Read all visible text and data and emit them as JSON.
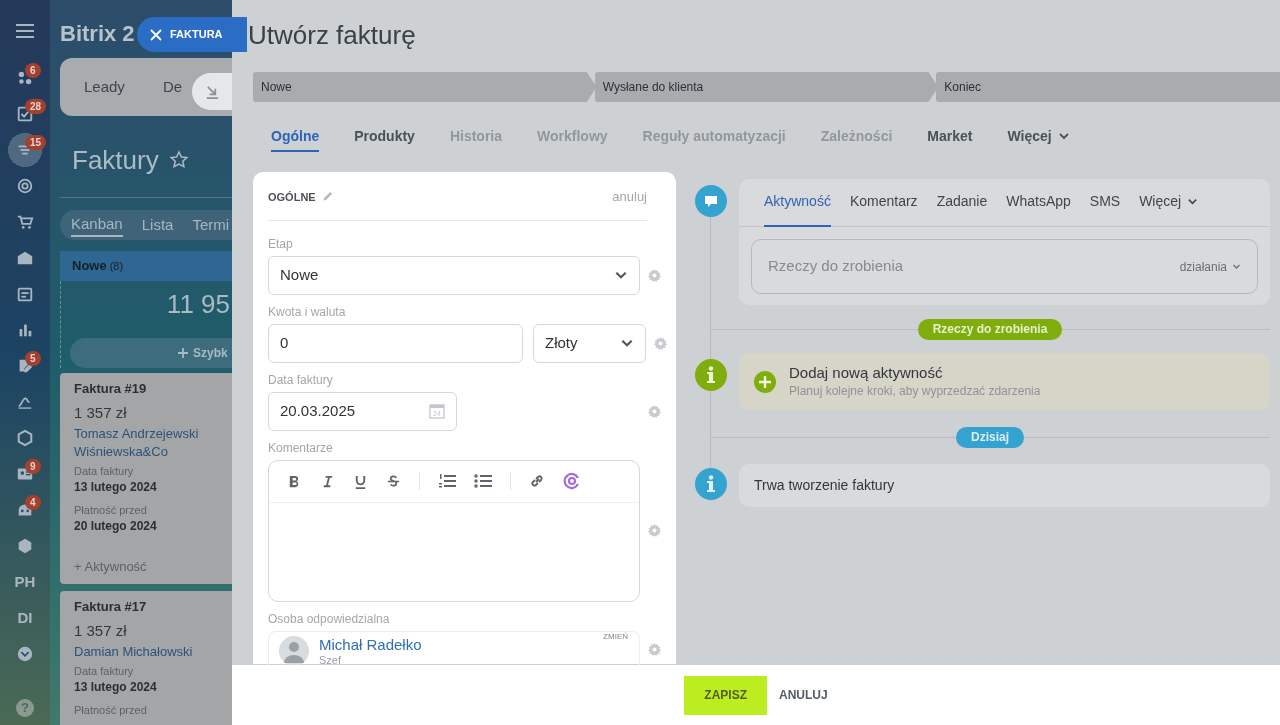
{
  "nav": {
    "items": [
      {
        "kind": "icon",
        "badge": "6",
        "selected": false
      },
      {
        "kind": "icon",
        "badge": "28",
        "selected": false
      },
      {
        "kind": "icon",
        "badge": "15",
        "selected": true
      },
      {
        "kind": "icon",
        "selected": false
      },
      {
        "kind": "icon",
        "selected": false
      },
      {
        "kind": "icon",
        "selected": false
      },
      {
        "kind": "icon",
        "selected": false
      },
      {
        "kind": "icon",
        "selected": false
      },
      {
        "kind": "icon",
        "badge": "5",
        "selected": false
      },
      {
        "kind": "icon",
        "selected": false
      },
      {
        "kind": "icon",
        "selected": false
      },
      {
        "kind": "icon",
        "badge": "9",
        "selected": false
      },
      {
        "kind": "icon",
        "badge": "4",
        "selected": false
      },
      {
        "kind": "icon",
        "selected": false
      },
      {
        "kind": "text",
        "label": "PH",
        "selected": false
      },
      {
        "kind": "text",
        "label": "DI",
        "selected": false
      },
      {
        "kind": "icon",
        "selected": false
      }
    ],
    "help_label": "?"
  },
  "background_page": {
    "logo": "Bitrix 2",
    "top_tabs": [
      "Leady",
      "De"
    ],
    "title": "Faktury",
    "view_tabs": [
      {
        "label": "Kanban",
        "selected": true
      },
      {
        "label": "Lista",
        "selected": false
      },
      {
        "label": "Termi",
        "selected": false
      }
    ],
    "column": {
      "title": "Nowe",
      "count": "(8)",
      "total": "11 95",
      "quick_add": "Szybk"
    },
    "cards": [
      {
        "title": "Faktura #19",
        "amount": "1 357 zł",
        "links": [
          "Tomasz Andrzejewski",
          "Wiśniewska&Co"
        ],
        "fields": [
          {
            "label": "Data faktury",
            "value": "13 lutego 2024"
          },
          {
            "label": "Płatność przed",
            "value": "20 lutego 2024"
          }
        ],
        "activity": "+ Aktywność"
      },
      {
        "title": "Faktura #17",
        "amount": "1 357 zł",
        "links": [
          "Damian Michałowski"
        ],
        "fields": [
          {
            "label": "Data faktury",
            "value": "13 lutego 2024"
          },
          {
            "label": "Płatność przed"
          }
        ]
      }
    ]
  },
  "slider": {
    "close_label": "FAKTURA",
    "title": "Utwórz fakturę",
    "stages": [
      "Nowe",
      "Wysłane do klienta",
      "Koniec"
    ],
    "tabs": [
      {
        "label": "Ogólne",
        "selected": true,
        "dimmed": false
      },
      {
        "label": "Produkty",
        "selected": false,
        "dimmed": false
      },
      {
        "label": "Historia",
        "selected": false,
        "dimmed": true
      },
      {
        "label": "Workflowy",
        "selected": false,
        "dimmed": true
      },
      {
        "label": "Reguły automatyzacji",
        "selected": false,
        "dimmed": true
      },
      {
        "label": "Zależności",
        "selected": false,
        "dimmed": true
      },
      {
        "label": "Market",
        "selected": false,
        "dimmed": false
      },
      {
        "label": "Więcej",
        "selected": false,
        "dimmed": false
      }
    ],
    "form": {
      "section_title": "OGÓLNE",
      "cancel": "anuluj",
      "stage": {
        "label": "Etap",
        "value": "Nowe"
      },
      "amount": {
        "label": "Kwota i waluta",
        "value": "0",
        "currency": "Złoty"
      },
      "date": {
        "label": "Data faktury",
        "value": "20.03.2025",
        "calendar_day": "24"
      },
      "comments": {
        "label": "Komentarze"
      },
      "responsible": {
        "label": "Osoba odpowiedzialna",
        "change": "ZMIEŃ",
        "name": "Michał Radełko",
        "role": "Szef"
      }
    },
    "timeline": {
      "tabs": [
        {
          "label": "Aktywność",
          "selected": true
        },
        {
          "label": "Komentarz",
          "selected": false
        },
        {
          "label": "Zadanie",
          "selected": false
        },
        {
          "label": "WhatsApp",
          "selected": false
        },
        {
          "label": "SMS",
          "selected": false
        },
        {
          "label": "Więcej",
          "selected": false
        }
      ],
      "input_placeholder": "Rzeczy do zrobienia",
      "actions": "działania",
      "todo_badge": "Rzeczy do zrobienia",
      "add_title": "Dodaj nową aktywność",
      "add_subtitle": "Planuj kolejne kroki, aby wyprzedzać zdarzenia",
      "today_badge": "Dzisiaj",
      "event": "Trwa tworzenie faktury"
    },
    "footer": {
      "save": "ZAPISZ",
      "cancel": "ANULUJ"
    }
  }
}
